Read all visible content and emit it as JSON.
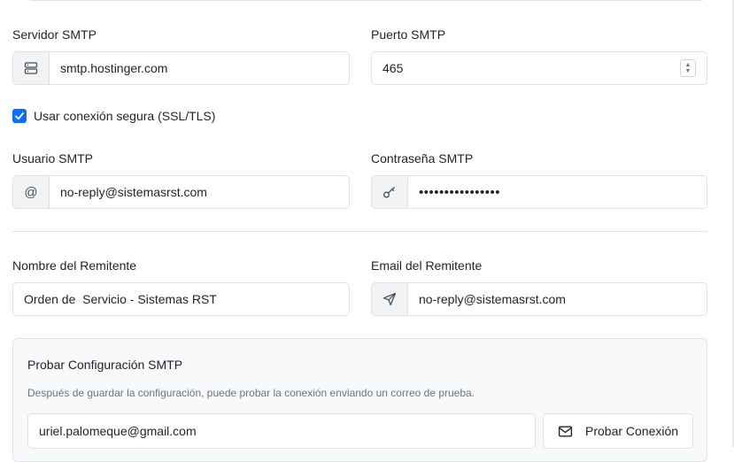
{
  "smtp": {
    "server_label": "Servidor SMTP",
    "server_value": "smtp.hostinger.com",
    "port_label": "Puerto SMTP",
    "port_value": "465",
    "ssl_label": "Usar conexión segura (SSL/TLS)",
    "ssl_checked": true,
    "user_label": "Usuario SMTP",
    "user_value": "no-reply@sistemasrst.com",
    "password_label": "Contraseña SMTP",
    "password_value": "••••••••••••••••"
  },
  "sender": {
    "name_label": "Nombre del Remitente",
    "name_value": "Orden de  Servicio - Sistemas RST",
    "email_label": "Email del Remitente",
    "email_value": "no-reply@sistemasrst.com"
  },
  "test": {
    "title": "Probar Configuración SMTP",
    "help": "Después de guardar la configuración, puede probar la conexión enviando un correo de prueba.",
    "email_value": "uriel.palomeque@gmail.com",
    "button_label": "Probar Conexión"
  },
  "icons": {
    "server": "server-icon",
    "at": "at-icon",
    "key": "key-icon",
    "send": "send-icon",
    "envelope": "envelope-icon"
  },
  "colors": {
    "accent": "#0d6efd",
    "addon_bg": "#f1f3f5",
    "border": "#dee2e6",
    "card_bg": "#f8f9fa",
    "muted": "#6c757d"
  }
}
